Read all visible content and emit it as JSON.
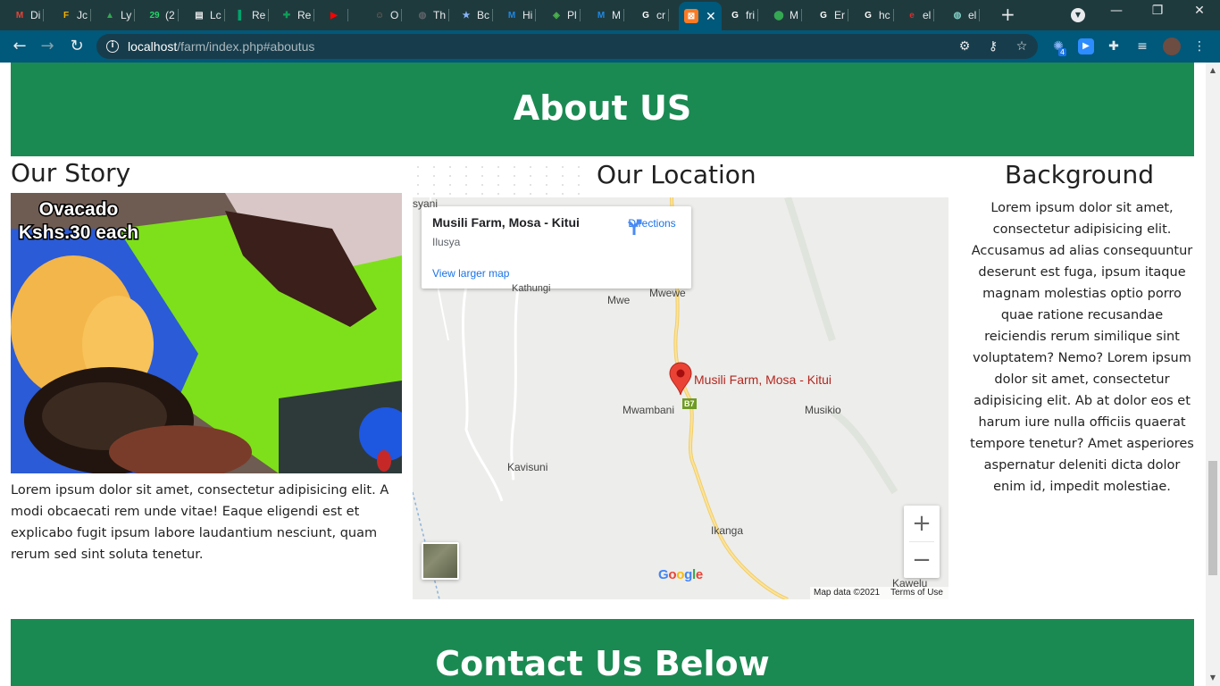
{
  "browser": {
    "tabs": [
      {
        "label": "Di",
        "icon": "gmail-icon",
        "color": "#ea4335",
        "glyph": "M"
      },
      {
        "label": "Jc",
        "icon": "jobs-icon",
        "color": "#f6b400",
        "glyph": "F"
      },
      {
        "label": "Ly",
        "icon": "drive-icon",
        "color": "#34a853",
        "glyph": "▲"
      },
      {
        "label": "(2",
        "icon": "whatsapp-icon",
        "color": "#25d366",
        "glyph": "29"
      },
      {
        "label": "Lc",
        "icon": "docs-icon",
        "color": "#e8eaed",
        "glyph": "▤"
      },
      {
        "label": "Re",
        "icon": "bookmark-icon",
        "color": "#00a36c",
        "glyph": "▌"
      },
      {
        "label": "Re",
        "icon": "sheets-icon",
        "color": "#0f9d58",
        "glyph": "✚"
      },
      {
        "label": "",
        "icon": "youtube-icon",
        "color": "#ff0000",
        "glyph": "▶"
      },
      {
        "label": "O",
        "icon": "person-icon",
        "color": "#8d6e63",
        "glyph": "☺"
      },
      {
        "label": "Th",
        "icon": "globe-icon",
        "color": "#5f6368",
        "glyph": "◍"
      },
      {
        "label": "Bc",
        "icon": "star-icon",
        "color": "#8ab4f8",
        "glyph": "★"
      },
      {
        "label": "Hi",
        "icon": "m-icon",
        "color": "#1e88e5",
        "glyph": "M"
      },
      {
        "label": "Pl",
        "icon": "crest-icon",
        "color": "#4caf50",
        "glyph": "◈"
      },
      {
        "label": "M",
        "icon": "m-icon",
        "color": "#1e88e5",
        "glyph": "M"
      },
      {
        "label": "cr",
        "icon": "google-icon",
        "color": "#ffffff",
        "glyph": "G"
      }
    ],
    "active_tab": {
      "icon": "xampp-icon",
      "glyph": "⊠",
      "color": "#fb7a24"
    },
    "tabs_after": [
      {
        "label": "fri",
        "icon": "google-icon",
        "color": "#ffffff",
        "glyph": "G"
      },
      {
        "label": "M",
        "icon": "maps-icon",
        "color": "#34a853",
        "glyph": "⬤"
      },
      {
        "label": "Er",
        "icon": "google-icon",
        "color": "#ffffff",
        "glyph": "G"
      },
      {
        "label": "hc",
        "icon": "google-icon",
        "color": "#ffffff",
        "glyph": "G"
      },
      {
        "label": "el",
        "icon": "e-icon",
        "color": "#d32f2f",
        "glyph": "e"
      },
      {
        "label": "el",
        "icon": "globe-icon",
        "color": "#80cbc4",
        "glyph": "◍"
      }
    ],
    "url_host": "localhost",
    "url_path": "/farm/index.php#aboutus",
    "extension_badge": "4"
  },
  "page": {
    "about_heading": "About US",
    "story_title": "Our Story",
    "story_image_caption_line1": "Ovacado",
    "story_image_caption_line2": "Kshs.30 each",
    "story_text": "Lorem ipsum dolor sit amet, consectetur adipisicing elit. A modi obcaecati rem unde vitae! Eaque eligendi est et explicabo fugit ipsum labore laudantium nesciunt, quam rerum sed sint soluta tenetur.",
    "location_title": "Our Location",
    "background_title": "Background",
    "background_text": "Lorem ipsum dolor sit amet, consectetur adipisicing elit. Accusamus ad alias consequuntur deserunt est fuga, ipsum itaque magnam molestias optio porro quae ratione recusandae reiciendis rerum similique sint voluptatem? Nemo? Lorem ipsum dolor sit amet, consectetur adipisicing elit. Ab at dolor eos et harum iure nulla officiis quaerat tempore tenetur? Amet asperiores aspernatur deleniti dicta dolor enim id, impedit molestiae.",
    "contact_heading": "Contact Us Below"
  },
  "map": {
    "place_name": "Musili Farm, Mosa - Kitui",
    "place_sub": "Ilusya",
    "directions_label": "Directions",
    "larger_map_label": "View larger map",
    "pin_label": "Musili Farm, Mosa - Kitui",
    "labels": {
      "syani": "syani",
      "kathungi": "Kathungi",
      "mwe": "Mwe",
      "mwewe": "Mwewe",
      "mwambani": "Mwambani",
      "musikio": "Musikio",
      "kavisuni": "Kavisuni",
      "ikanga": "Ikanga",
      "kawelu": "Kawelu"
    },
    "road_badge": "B7",
    "zoom_in": "+",
    "zoom_out": "−",
    "map_data": "Map data ©2021",
    "terms": "Terms of Use",
    "logo": "Google"
  }
}
